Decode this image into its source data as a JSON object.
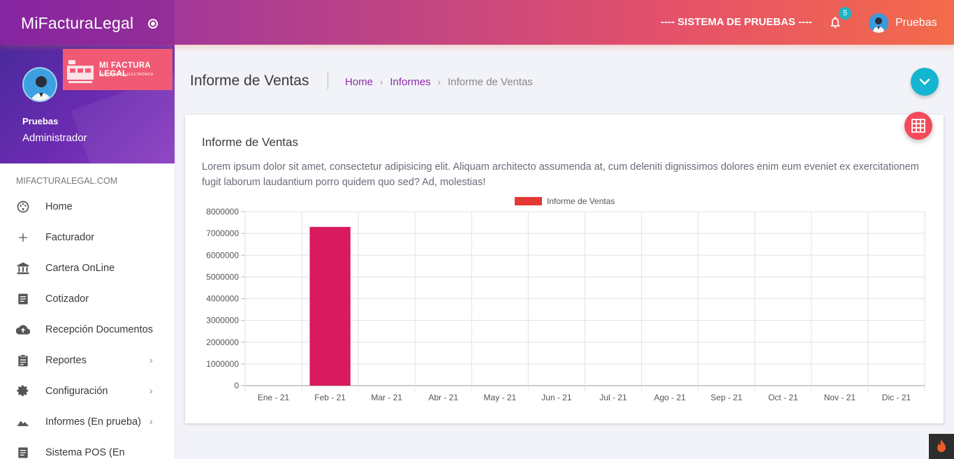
{
  "app": {
    "brand": "MiFacturaLegal"
  },
  "topbar": {
    "system_label": "---- SISTEMA DE PRUEBAS ----",
    "notifications": "5",
    "user": "Pruebas"
  },
  "sidebar": {
    "profile_name": "Pruebas",
    "profile_role": "Administrador",
    "logo_title": "MI FACTURA LEGAL",
    "logo_subtitle": "FACTURACIÓN ELECTRÓNICA",
    "section_label": "MIFACTURALEGAL.COM",
    "items": [
      {
        "label": "Home",
        "icon": "palette-icon",
        "has_submenu": false
      },
      {
        "label": "Facturador",
        "icon": "plus-icon",
        "has_submenu": false
      },
      {
        "label": "Cartera OnLine",
        "icon": "bank-icon",
        "has_submenu": false
      },
      {
        "label": "Cotizador",
        "icon": "document-icon",
        "has_submenu": false
      },
      {
        "label": "Recepción Documentos",
        "icon": "cloud-upload-icon",
        "has_submenu": false
      },
      {
        "label": "Reportes",
        "icon": "clipboard-icon",
        "has_submenu": true
      },
      {
        "label": "Configuración",
        "icon": "gear-icon",
        "has_submenu": true
      },
      {
        "label": "Informes (En prueba)",
        "icon": "landscape-icon",
        "has_submenu": true
      },
      {
        "label": "Sistema POS (En",
        "icon": "document-icon",
        "has_submenu": false
      }
    ]
  },
  "page": {
    "title": "Informe de Ventas",
    "breadcrumb": [
      "Home",
      "Informes",
      "Informe de Ventas"
    ]
  },
  "card": {
    "title": "Informe de Ventas",
    "description": "Lorem ipsum dolor sit amet, consectetur adipisicing elit. Aliquam architecto assumenda at, cum deleniti dignissimos dolores enim eum eveniet ex exercitationem fugit laborum laudantium porro quidem quo sed? Ad, molestias!"
  },
  "chart_data": {
    "type": "bar",
    "categories": [
      "Ene - 21",
      "Feb - 21",
      "Mar - 21",
      "Abr - 21",
      "May - 21",
      "Jun - 21",
      "Jul - 21",
      "Ago - 21",
      "Sep - 21",
      "Oct - 21",
      "Nov - 21",
      "Dic - 21"
    ],
    "series": [
      {
        "name": "Informe de Ventas",
        "values": [
          0,
          7300000,
          0,
          0,
          0,
          0,
          0,
          0,
          0,
          0,
          0,
          0
        ]
      }
    ],
    "yticks": [
      "0",
      "1000000",
      "2000000",
      "3000000",
      "4000000",
      "5000000",
      "6000000",
      "7000000",
      "8000000"
    ],
    "ylim": [
      0,
      8000000
    ],
    "legend": "top-center",
    "grid": true,
    "colors": {
      "bar": "#d81b5e",
      "legend_swatch": "#e53935"
    }
  }
}
